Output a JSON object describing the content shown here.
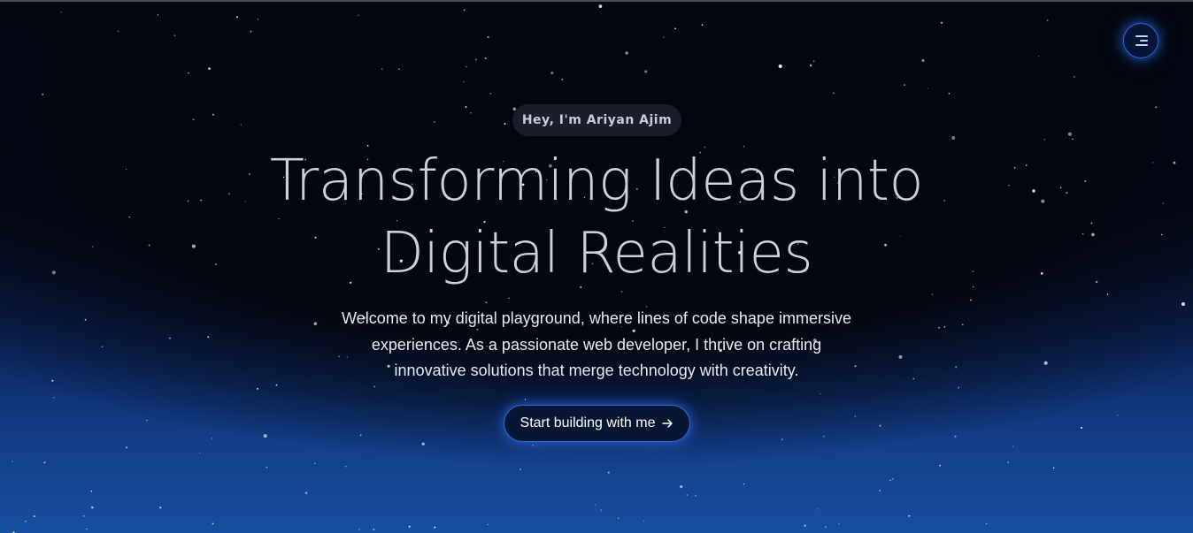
{
  "hero": {
    "greeting": "Hey, I'm Ariyan Ajim",
    "headline_line1": "Transforming Ideas into",
    "headline_line2": "Digital Realities",
    "intro_line1": "Welcome to my digital playground, where lines of code shape immersive",
    "intro_line2": "experiences. As a passionate web developer, I thrive on crafting",
    "intro_line3": "innovative solutions that merge technology with creativity.",
    "cta_label": "Start building with me",
    "cta_icon": "arrow-right-icon"
  },
  "nav": {
    "menu_icon": "menu-icon"
  },
  "colors": {
    "background_top": "#03060f",
    "background_bottom": "#1650a0",
    "accent_glow": "#2e67d8",
    "text": "#e8eaf0"
  }
}
